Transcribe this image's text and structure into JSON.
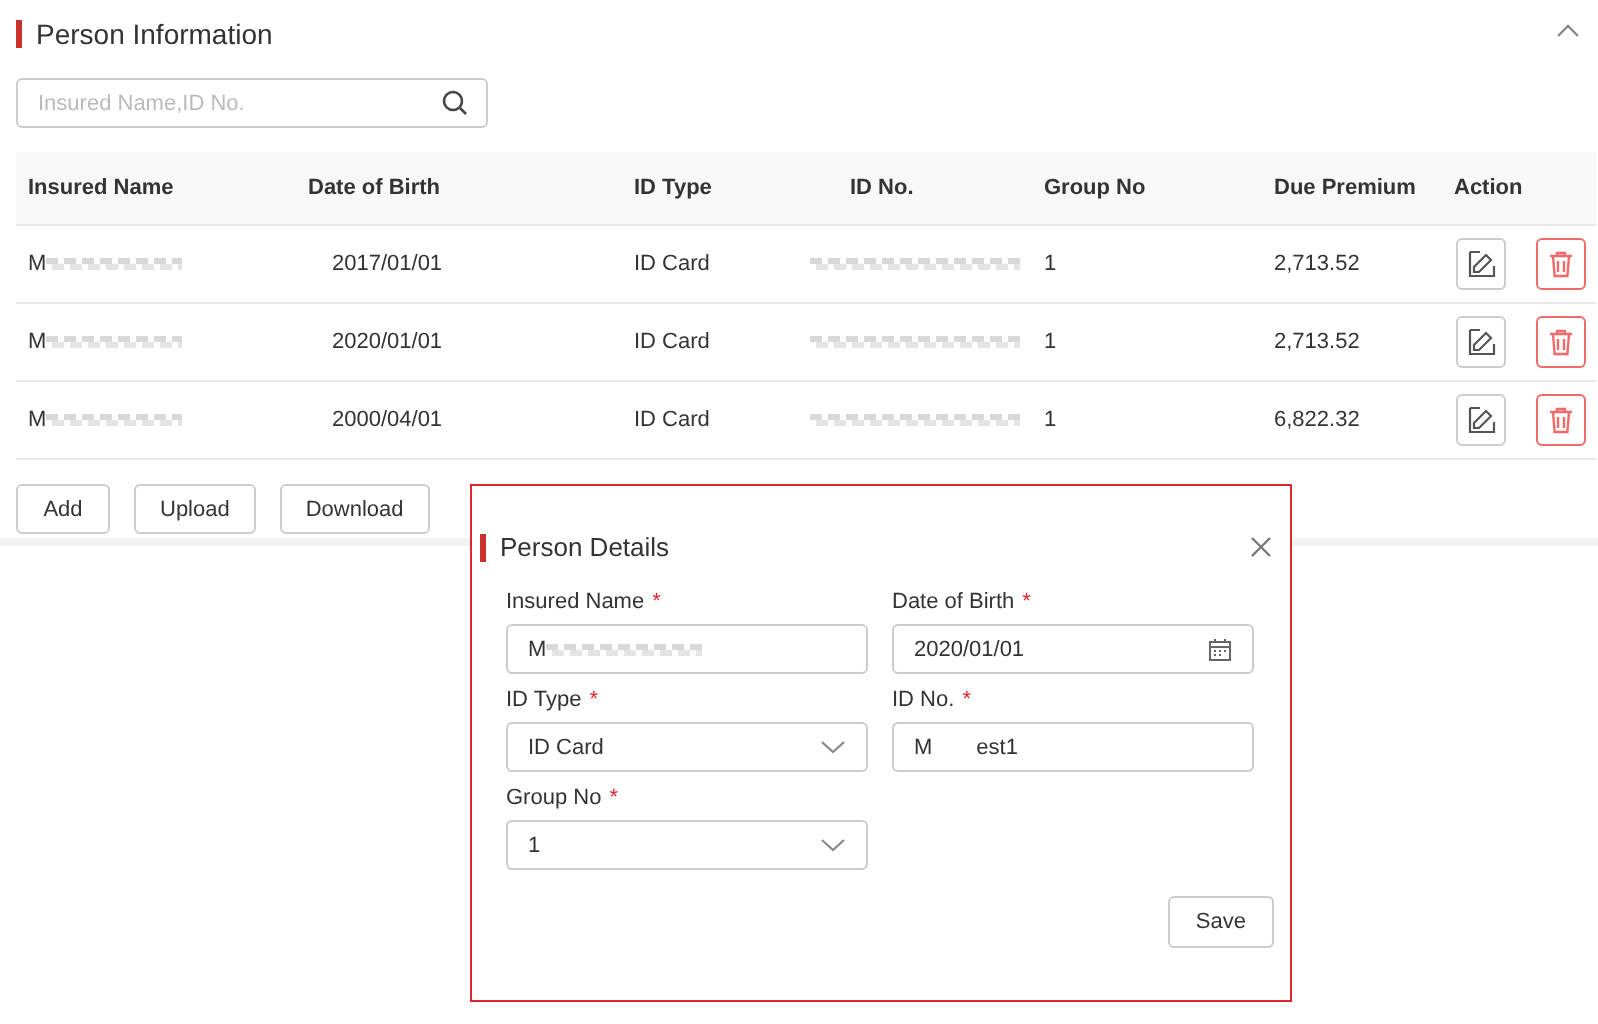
{
  "section": {
    "title": "Person Information",
    "expanded": true
  },
  "search": {
    "placeholder": "Insured Name,ID No."
  },
  "table": {
    "columns": [
      "Insured Name",
      "Date of Birth",
      "ID Type",
      "ID No.",
      "Group No",
      "Due Premium",
      "Action"
    ],
    "rows": [
      {
        "insured_name": {
          "text": "M",
          "redacted": true
        },
        "date_of_birth": "2017/01/01",
        "id_type": "ID Card",
        "id_no": {
          "redacted": true
        },
        "group_no": "1",
        "due_premium": "2,713.52"
      },
      {
        "insured_name": {
          "text": "M",
          "redacted": true
        },
        "date_of_birth": "2020/01/01",
        "id_type": "ID Card",
        "id_no": {
          "redacted": true
        },
        "group_no": "1",
        "due_premium": "2,713.52"
      },
      {
        "insured_name": {
          "text": "M",
          "redacted": true
        },
        "date_of_birth": "2000/04/01",
        "id_type": "ID Card",
        "id_no": {
          "redacted": true
        },
        "group_no": "1",
        "due_premium": "6,822.32"
      }
    ]
  },
  "buttons": [
    "Add",
    "Upload",
    "Download"
  ],
  "dialog": {
    "title": "Person Details",
    "fields": [
      {
        "label": "Insured Name",
        "required_mark": "*",
        "kind": "text",
        "value": "M",
        "redacted": true
      },
      {
        "label": "Date of Birth",
        "required_mark": "*",
        "kind": "date",
        "value": "2020/01/01"
      },
      {
        "label": "ID Type",
        "required_mark": "*",
        "kind": "select",
        "value": "ID Card"
      },
      {
        "label": "ID No.",
        "required_mark": "*",
        "kind": "text",
        "value": "M",
        "value_tail": "est1"
      },
      {
        "label": "Group No",
        "required_mark": "*",
        "kind": "select",
        "value": "1"
      }
    ],
    "save_button": "Save"
  }
}
